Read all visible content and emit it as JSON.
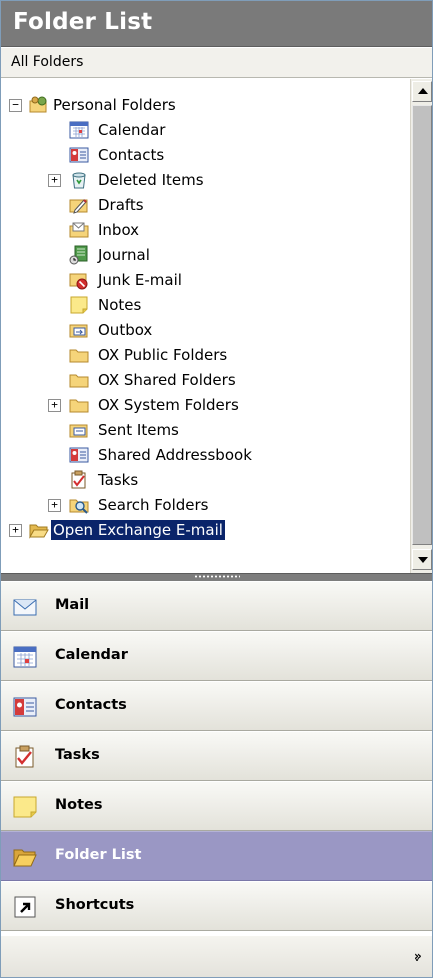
{
  "header": {
    "title": "Folder List"
  },
  "subheader": {
    "label": "All Folders"
  },
  "tree": {
    "root": {
      "label": "Personal Folders",
      "icon": "personal-folders-icon",
      "expander": "−"
    },
    "items": [
      {
        "label": "Calendar",
        "icon": "calendar-icon"
      },
      {
        "label": "Contacts",
        "icon": "contacts-icon"
      },
      {
        "label": "Deleted Items",
        "icon": "deleted-items-icon",
        "expander": "+"
      },
      {
        "label": "Drafts",
        "icon": "drafts-icon"
      },
      {
        "label": "Inbox",
        "icon": "inbox-icon"
      },
      {
        "label": "Journal",
        "icon": "journal-icon"
      },
      {
        "label": "Junk E-mail",
        "icon": "junk-email-icon"
      },
      {
        "label": "Notes",
        "icon": "notes-icon"
      },
      {
        "label": "Outbox",
        "icon": "outbox-icon"
      },
      {
        "label": "OX Public Folders",
        "icon": "folder-icon"
      },
      {
        "label": "OX Shared Folders",
        "icon": "folder-icon"
      },
      {
        "label": "OX System Folders",
        "icon": "folder-icon",
        "expander": "+"
      },
      {
        "label": "Sent Items",
        "icon": "sent-items-icon"
      },
      {
        "label": "Shared Addressbook",
        "icon": "contacts-icon"
      },
      {
        "label": "Tasks",
        "icon": "tasks-icon"
      },
      {
        "label": "Search Folders",
        "icon": "search-folders-icon",
        "expander": "+"
      }
    ],
    "second_root": {
      "label": "Open Exchange E-mail",
      "icon": "open-folder-icon",
      "expander": "+",
      "selected": true
    }
  },
  "nav": {
    "buttons": [
      {
        "label": "Mail",
        "icon": "mail-icon"
      },
      {
        "label": "Calendar",
        "icon": "calendar-icon"
      },
      {
        "label": "Contacts",
        "icon": "contacts-icon"
      },
      {
        "label": "Tasks",
        "icon": "tasks-icon"
      },
      {
        "label": "Notes",
        "icon": "notes-icon"
      },
      {
        "label": "Folder List",
        "icon": "folder-list-icon",
        "active": true
      },
      {
        "label": "Shortcuts",
        "icon": "shortcut-icon"
      }
    ],
    "configure_icon": "chevron-double-down-icon"
  },
  "colors": {
    "header_bg": "#7a7a7a",
    "active_nav_bg": "#9a97c4",
    "selected_bg": "#0a246a"
  }
}
